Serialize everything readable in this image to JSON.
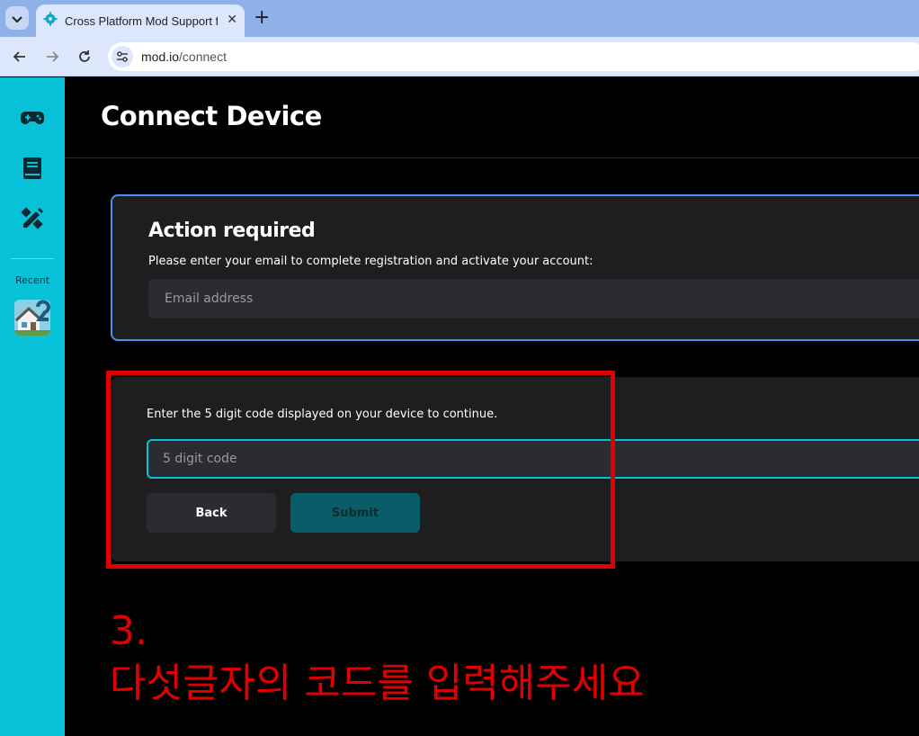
{
  "browser": {
    "tab_title": "Cross Platform Mod Support f",
    "url_host": "mod.io",
    "url_path": "/connect"
  },
  "sidebar": {
    "recent_label": "Recent",
    "accent_color": "#07c1d8"
  },
  "page": {
    "title": "Connect Device"
  },
  "action_card": {
    "heading": "Action required",
    "description": "Please enter your email to complete registration and activate your account:",
    "email_placeholder": "Email address"
  },
  "code_card": {
    "instruction": "Enter the 5 digit code displayed on your device to continue.",
    "code_placeholder": "5 digit code",
    "back_label": "Back",
    "submit_label": "Submit"
  },
  "annotation": {
    "step": "3.",
    "text": "다섯글자의 코드를 입력해주세요"
  }
}
